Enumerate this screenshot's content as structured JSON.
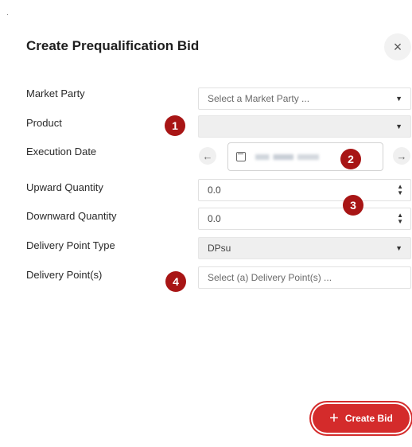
{
  "modal": {
    "title": "Create Prequalification Bid",
    "close_icon": "×"
  },
  "fields": {
    "market_party": {
      "label": "Market Party",
      "placeholder": "Select a Market Party ..."
    },
    "product": {
      "label": "Product",
      "value": ""
    },
    "execution_date": {
      "label": "Execution Date",
      "prev_icon": "←",
      "next_icon": "→"
    },
    "upward_quantity": {
      "label": "Upward Quantity",
      "value": "0.0"
    },
    "downward_quantity": {
      "label": "Downward Quantity",
      "value": "0.0"
    },
    "delivery_point_type": {
      "label": "Delivery Point Type",
      "value": "DPsu"
    },
    "delivery_points": {
      "label": "Delivery Point(s)",
      "placeholder": "Select (a) Delivery Point(s) ..."
    }
  },
  "icons": {
    "caret": "▼",
    "stepper_up": "▲",
    "stepper_down": "▼"
  },
  "annotations": [
    "1",
    "2",
    "3",
    "4"
  ],
  "actions": {
    "create_plus": "+",
    "create_label": "Create Bid"
  },
  "colors": {
    "accent": "#d42b2b",
    "badge": "#a81515"
  }
}
